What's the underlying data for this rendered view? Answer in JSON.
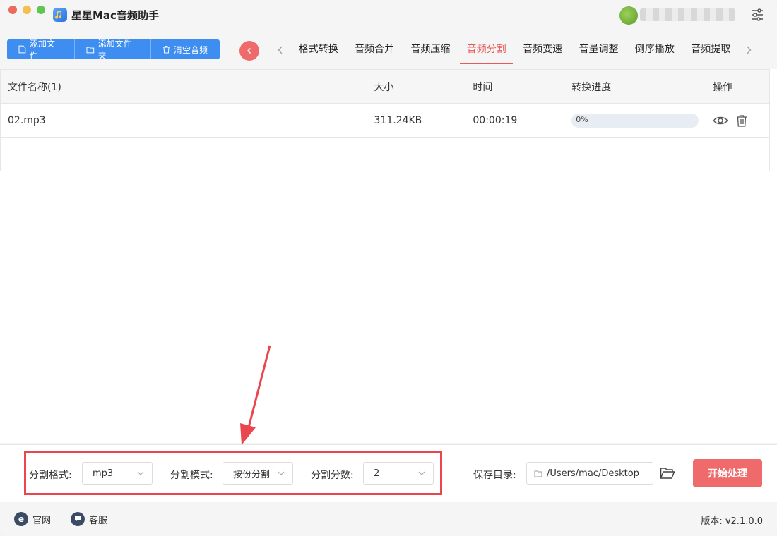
{
  "app": {
    "title": "星星Mac音频助手"
  },
  "toolbar": {
    "add_file": "添加文件",
    "add_folder": "添加文件夹",
    "clear_audio": "清空音频"
  },
  "tabs": [
    {
      "label": "格式转换",
      "active": false
    },
    {
      "label": "音频合并",
      "active": false
    },
    {
      "label": "音频压缩",
      "active": false
    },
    {
      "label": "音频分割",
      "active": true
    },
    {
      "label": "音频变速",
      "active": false
    },
    {
      "label": "音量调整",
      "active": false
    },
    {
      "label": "倒序播放",
      "active": false
    },
    {
      "label": "音频提取",
      "active": false
    }
  ],
  "table": {
    "headers": {
      "name": "文件名称(1)",
      "size": "大小",
      "time": "时间",
      "progress": "转换进度",
      "ops": "操作"
    },
    "rows": [
      {
        "name": "02.mp3",
        "size": "311.24KB",
        "time": "00:00:19",
        "progress": "0%",
        "progress_value": 0
      }
    ]
  },
  "settings": {
    "format_label": "分割格式:",
    "format_value": "mp3",
    "mode_label": "分割模式:",
    "mode_value": "按份分割",
    "count_label": "分割分数:",
    "count_value": "2",
    "save_label": "保存目录:",
    "save_path": "/Users/mac/Desktop",
    "start_button": "开始处理"
  },
  "footer": {
    "website": "官网",
    "support": "客服",
    "version": "版本: v2.1.0.0"
  },
  "colors": {
    "accent": "#3d8ef0",
    "danger": "#ef6a6a",
    "annotation": "#e9474d"
  }
}
